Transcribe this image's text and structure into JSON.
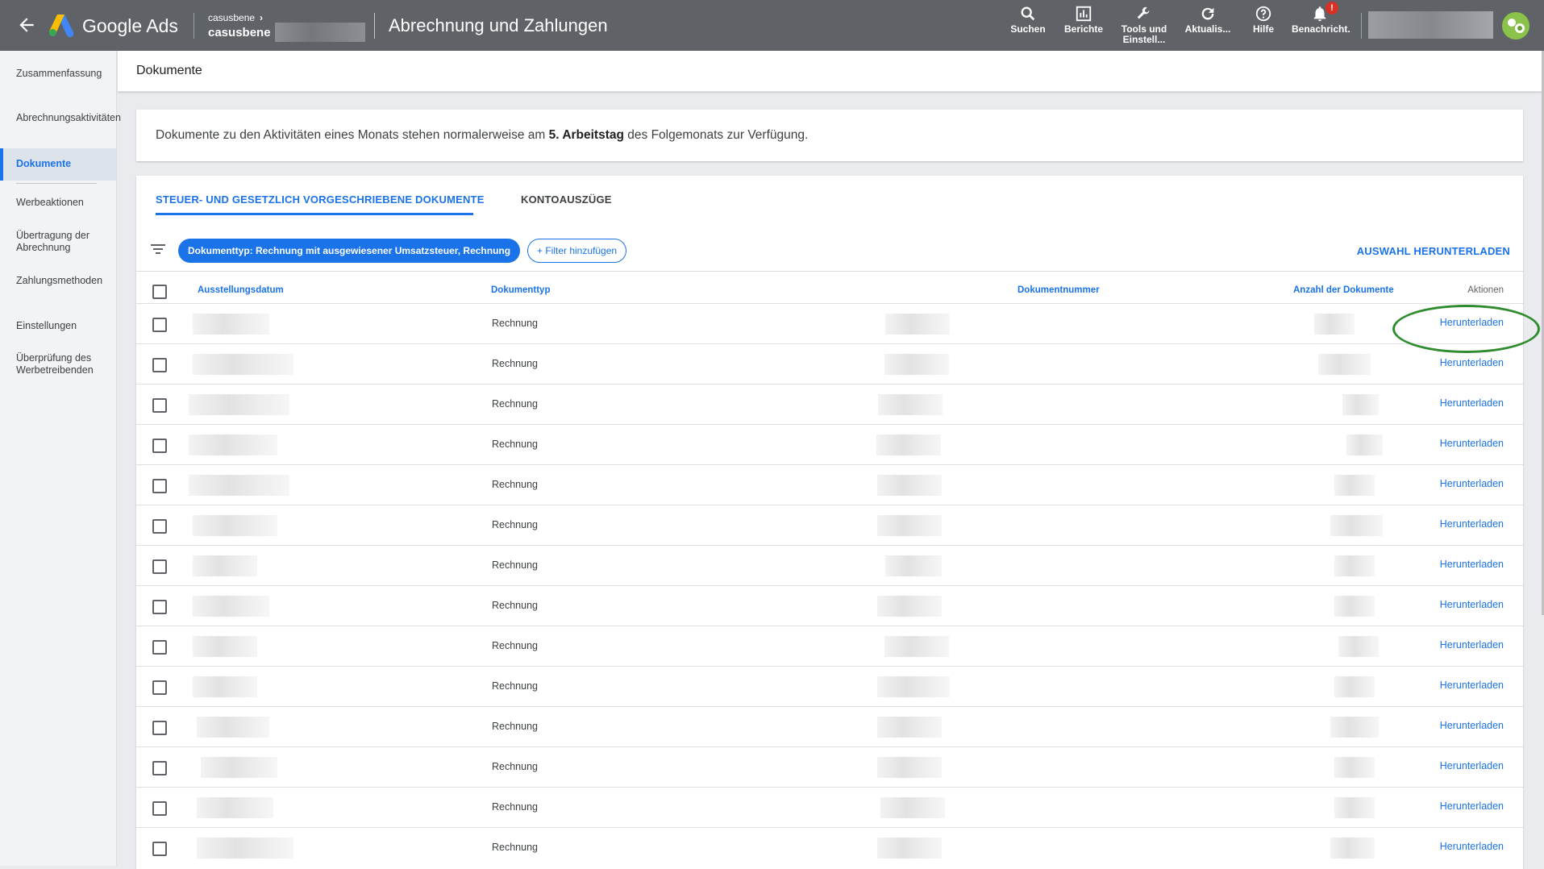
{
  "topbar": {
    "brand": "Google Ads",
    "account_top": "casusbene",
    "account_name": "casusbene",
    "page_title": "Abrechnung und Zahlungen",
    "tools": [
      {
        "label": "Suchen",
        "icon": "search-icon"
      },
      {
        "label": "Berichte",
        "icon": "reports-icon"
      },
      {
        "label": "Tools und Einstell...",
        "icon": "wrench-icon"
      },
      {
        "label": "Aktualis...",
        "icon": "refresh-icon"
      },
      {
        "label": "Hilfe",
        "icon": "help-icon"
      },
      {
        "label": "Benachricht.",
        "icon": "bell-icon",
        "badge": "!"
      }
    ]
  },
  "sidebar": {
    "items": [
      {
        "label": "Zusammenfassung"
      },
      {
        "label": "Abrechnungsaktivitäten"
      },
      {
        "label": "Dokumente",
        "active": true
      },
      {
        "label": "Werbeaktionen"
      },
      {
        "label": "Übertragung der Abrechnung"
      },
      {
        "label": "Zahlungsmethoden"
      },
      {
        "label": "Einstellungen"
      },
      {
        "label": "Überprüfung des Werbetreibenden"
      }
    ]
  },
  "content": {
    "header": "Dokumente",
    "info_pre": "Dokumente zu den Aktivitäten eines Monats stehen normalerweise am ",
    "info_bold": "5. Arbeitstag",
    "info_post": " des Folgemonats zur Verfügung."
  },
  "tabs": [
    {
      "label": "STEUER- UND GESETZLICH VORGESCHRIEBENE DOKUMENTE",
      "active": true
    },
    {
      "label": "KONTOAUSZÜGE",
      "active": false
    }
  ],
  "filters": {
    "chip": "Dokumenttyp: Rechnung mit ausgewiesener Umsatzsteuer, Rechnung",
    "add_filter": "+ Filter hinzufügen",
    "download_selected": "AUSWAHL HERUNTERLADEN"
  },
  "table": {
    "columns": [
      "Ausstellungsdatum",
      "Dokumenttyp",
      "Dokumentnummer",
      "Anzahl der Dokumente",
      "Aktionen"
    ],
    "rows": [
      {
        "type": "Rechnung",
        "action": "Herunterladen"
      },
      {
        "type": "Rechnung",
        "action": "Herunterladen"
      },
      {
        "type": "Rechnung",
        "action": "Herunterladen"
      },
      {
        "type": "Rechnung",
        "action": "Herunterladen"
      },
      {
        "type": "Rechnung",
        "action": "Herunterladen"
      },
      {
        "type": "Rechnung",
        "action": "Herunterladen"
      },
      {
        "type": "Rechnung",
        "action": "Herunterladen"
      },
      {
        "type": "Rechnung",
        "action": "Herunterladen"
      },
      {
        "type": "Rechnung",
        "action": "Herunterladen"
      },
      {
        "type": "Rechnung",
        "action": "Herunterladen"
      },
      {
        "type": "Rechnung",
        "action": "Herunterladen"
      },
      {
        "type": "Rechnung",
        "action": "Herunterladen"
      },
      {
        "type": "Rechnung",
        "action": "Herunterladen"
      },
      {
        "type": "Rechnung",
        "action": "Herunterladen"
      }
    ]
  },
  "colors": {
    "topbar": "#5f6368",
    "accent": "#1a73e8",
    "highlight_ellipse": "#2e8b2e"
  }
}
